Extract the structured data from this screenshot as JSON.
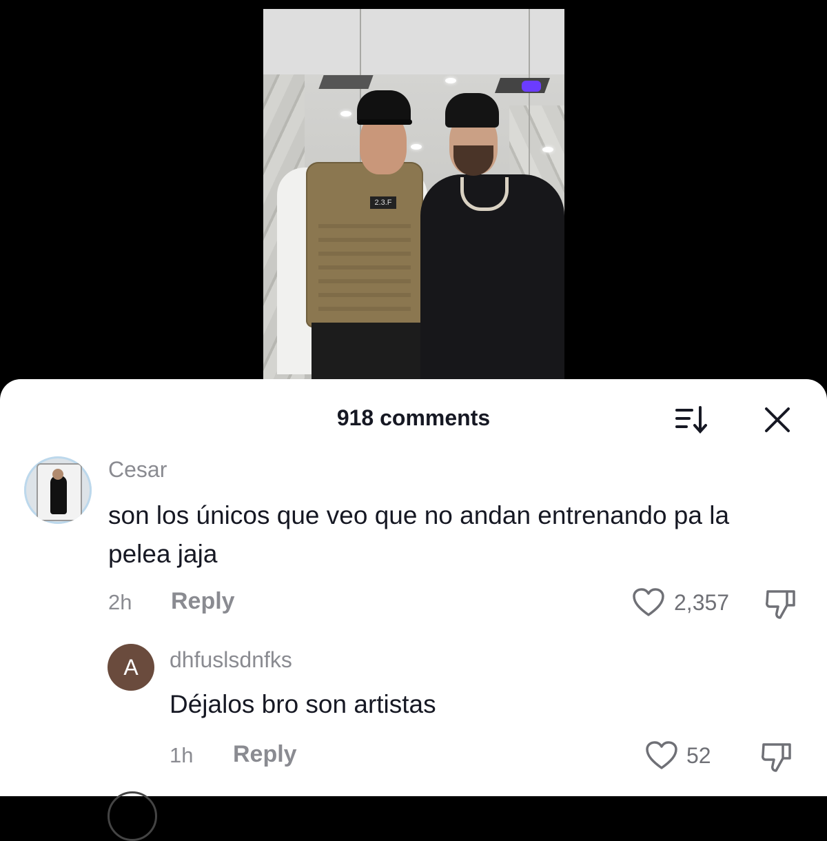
{
  "comments_sheet": {
    "title": "918 comments",
    "sort_icon": "sort-descending-icon",
    "close_icon": "close-icon"
  },
  "comments": [
    {
      "username": "Cesar",
      "text": "son los únicos que veo que no andan entrenando pa la pelea jaja",
      "time": "2h",
      "reply_label": "Reply",
      "likes": "2,357",
      "avatar": "photo"
    }
  ],
  "replies": [
    {
      "username": "dhfuslsdnfks",
      "avatar_letter": "A",
      "text": "Déjalos bro son artistas",
      "time": "1h",
      "reply_label": "Reply",
      "likes": "52"
    }
  ],
  "colors": {
    "sheet_bg": "#ffffff",
    "text_primary": "#161823",
    "text_secondary": "#8a8b91",
    "avatar_letter_bg": "#6a4b3d"
  }
}
